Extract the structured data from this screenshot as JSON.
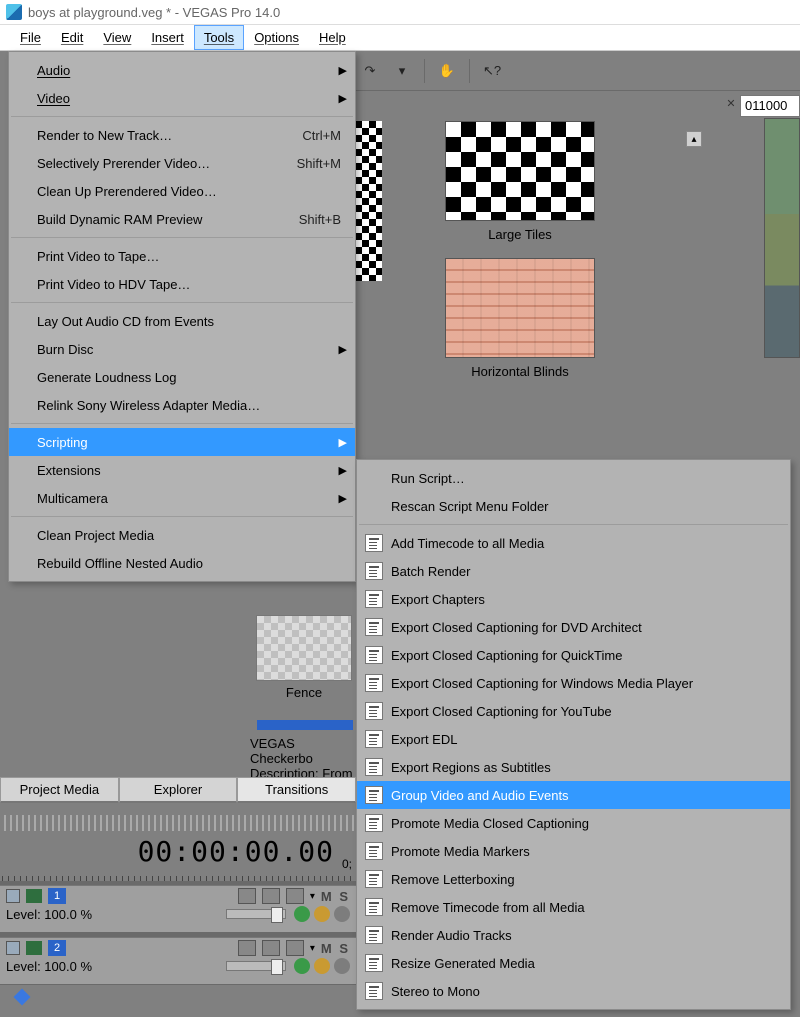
{
  "window": {
    "title": "boys at playground.veg * - VEGAS Pro 14.0"
  },
  "menubar": {
    "file": "File",
    "edit": "Edit",
    "view": "View",
    "insert": "Insert",
    "tools": "Tools",
    "options": "Options",
    "help": "Help",
    "active": "tools"
  },
  "tools_menu": {
    "audio": "Audio",
    "video": "Video",
    "render_new_track": "Render to New Track…",
    "render_new_track_shortcut": "Ctrl+M",
    "selectively_prerender": "Selectively Prerender Video…",
    "selectively_prerender_shortcut": "Shift+M",
    "clean_up_prerendered": "Clean Up Prerendered Video…",
    "build_dynamic_ram": "Build Dynamic RAM Preview",
    "build_dynamic_ram_shortcut": "Shift+B",
    "print_video_tape": "Print Video to Tape…",
    "print_video_hdv": "Print Video to HDV Tape…",
    "layout_audio_cd": "Lay Out Audio CD from Events",
    "burn_disc": "Burn Disc",
    "generate_loudness": "Generate Loudness Log",
    "relink_sony": "Relink Sony Wireless Adapter Media…",
    "scripting": "Scripting",
    "extensions": "Extensions",
    "multicamera": "Multicamera",
    "clean_project_media": "Clean Project Media",
    "rebuild_offline_nested": "Rebuild Offline Nested Audio"
  },
  "scripting_menu": {
    "run_script": "Run Script…",
    "rescan": "Rescan Script Menu Folder",
    "items": [
      "Add Timecode to all Media",
      "Batch Render",
      "Export Chapters",
      "Export Closed Captioning for DVD Architect",
      "Export Closed Captioning for QuickTime",
      "Export Closed Captioning for Windows Media Player",
      "Export Closed Captioning for YouTube",
      "Export EDL",
      "Export Regions as Subtitles",
      "Group Video and Audio Events",
      "Promote Media Closed Captioning",
      "Promote Media Markers",
      "Remove Letterboxing",
      "Remove Timecode from all Media",
      "Render Audio Tracks",
      "Resize Generated Media",
      "Stereo to Mono"
    ],
    "highlighted_index": 9
  },
  "thumbnails": {
    "large_tiles": "Large Tiles",
    "horizontal_blinds": "Horizontal Blinds",
    "fence": "Fence",
    "checkerboard_title": "VEGAS Checkerbo",
    "checkerboard_desc": "Description: From"
  },
  "lower_tabs": {
    "project_media": "Project Media",
    "explorer": "Explorer",
    "transitions": "Transitions"
  },
  "timeline": {
    "timecode": "00:00:00.00",
    "frame_label": "0;",
    "timestamp_field": "011000",
    "track1": {
      "num": "1",
      "level": "Level: 100.0 %",
      "ms": "M  S"
    },
    "track2": {
      "num": "2",
      "level": "Level: 100.0 %",
      "ms": "M  S"
    }
  }
}
